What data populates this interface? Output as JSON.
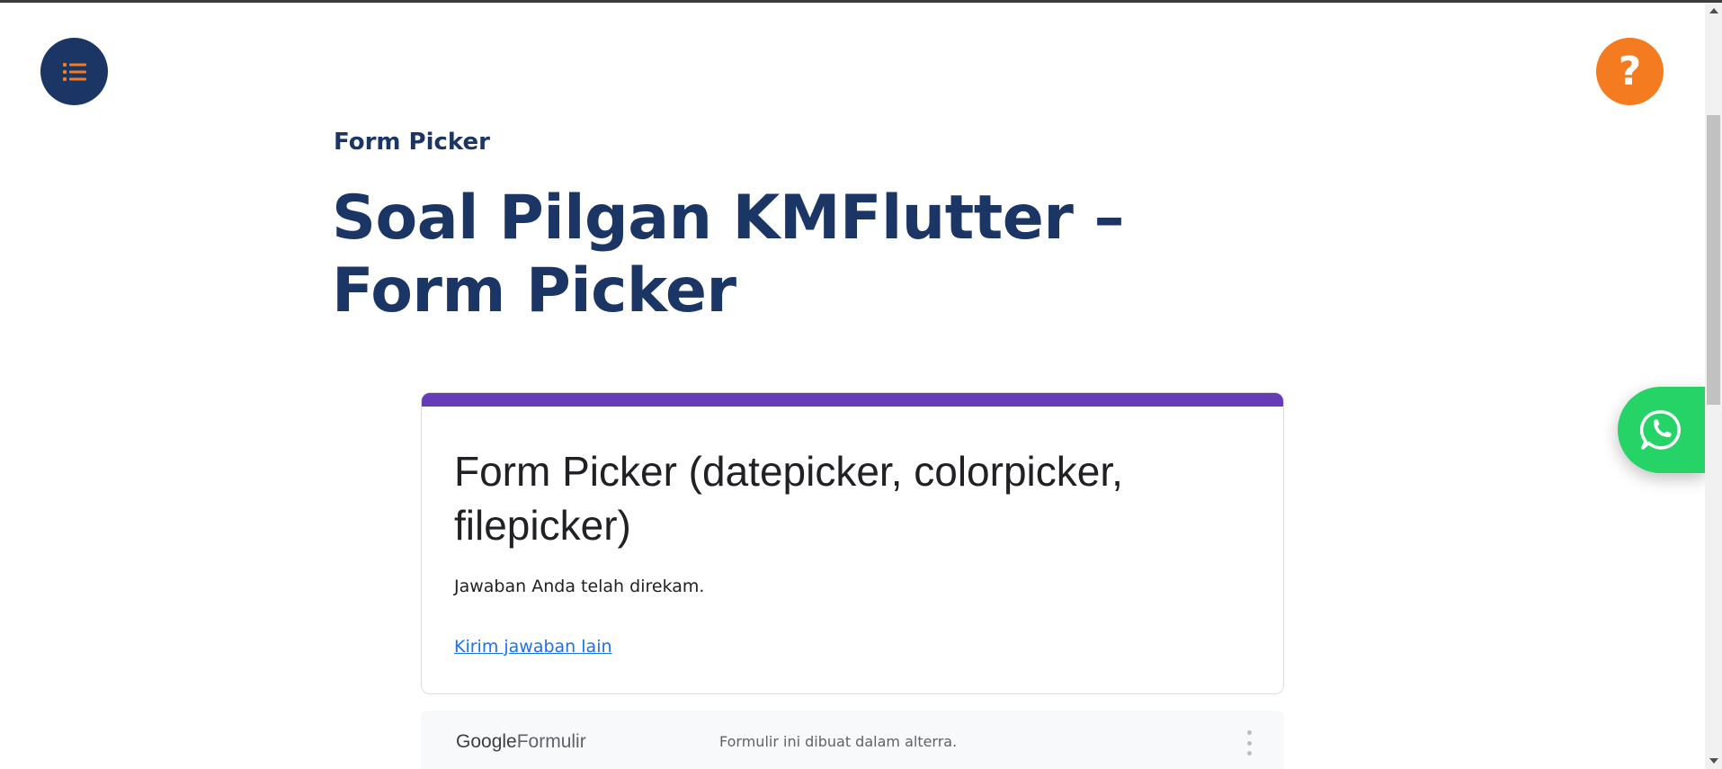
{
  "header": {
    "menu_icon": "list-icon",
    "help_label": "?"
  },
  "breadcrumb": "Form Picker",
  "page_title": "Soal Pilgan KMFlutter – Form Picker",
  "form": {
    "title": "Form Picker  (datepicker, colorpicker, filepicker)",
    "message": "Jawaban Anda telah direkam.",
    "link": "Kirim jawaban lain",
    "accent_color": "#673ab7"
  },
  "footer": {
    "logo_google": "Google",
    "logo_product": "Formulir",
    "note": "Formulir ini dibuat dalam alterra.",
    "more_icon": "more-vertical-icon"
  },
  "floating": {
    "whatsapp_icon": "whatsapp-icon"
  },
  "colors": {
    "navy": "#1b3564",
    "orange": "#f47b20",
    "green": "#25d366",
    "link_blue": "#1a73e8"
  }
}
